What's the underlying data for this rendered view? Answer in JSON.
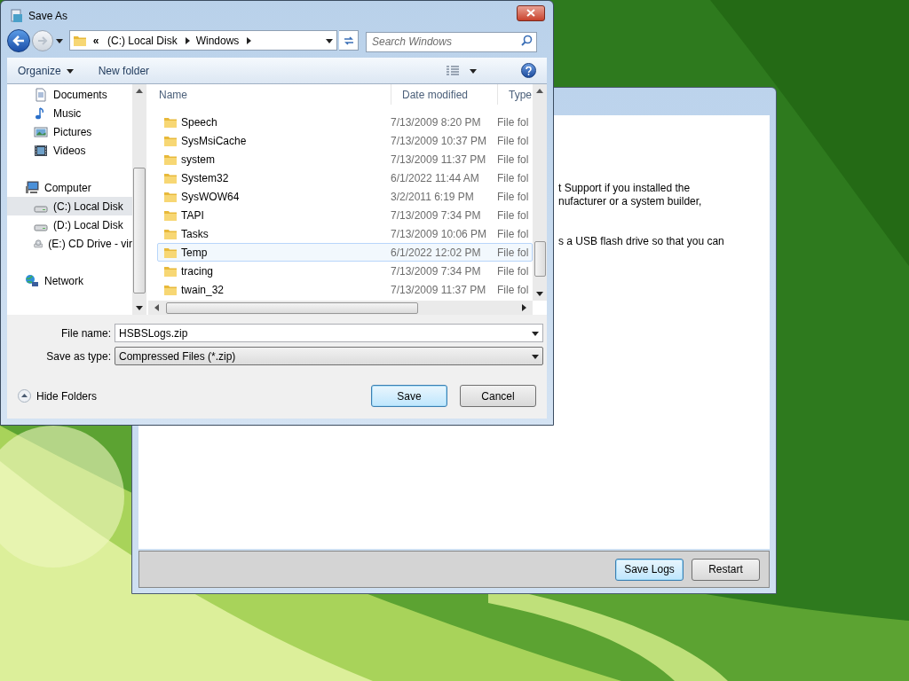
{
  "background_window": {
    "text_lines": [
      "t Support if you installed the",
      "nufacturer or a system builder,",
      "s a USB flash drive so that you can"
    ],
    "buttons": [
      {
        "label": "Save Logs",
        "default": true
      },
      {
        "label": "Restart",
        "default": false
      }
    ]
  },
  "dialog": {
    "title": "Save As",
    "breadcrumb": {
      "overflow": "«",
      "parts": [
        "(C:) Local Disk",
        "Windows"
      ]
    },
    "search": {
      "placeholder": "Search Windows"
    },
    "toolbar": [
      {
        "label": "Organize",
        "dropdown": true
      },
      {
        "label": "New folder",
        "dropdown": false
      }
    ],
    "nav": [
      {
        "kind": "documents",
        "label": "Documents",
        "selected": false
      },
      {
        "kind": "music",
        "label": "Music",
        "selected": false
      },
      {
        "kind": "pictures",
        "label": "Pictures",
        "selected": false
      },
      {
        "kind": "videos",
        "label": "Videos",
        "selected": false
      },
      {
        "kind": "computer",
        "label": "Computer",
        "selected": false,
        "children": [
          {
            "kind": "disk",
            "label": "(C:) Local Disk",
            "selected": true
          },
          {
            "kind": "disk",
            "label": "(D:) Local Disk",
            "selected": false
          },
          {
            "kind": "cd",
            "label": "(E:) CD Drive - vir",
            "selected": false
          }
        ]
      },
      {
        "kind": "network",
        "label": "Network",
        "selected": false
      }
    ],
    "columns": [
      "Name",
      "Date modified",
      "Type"
    ],
    "rows": [
      {
        "name": "Speech",
        "date": "7/13/2009 8:20 PM",
        "type": "File fol",
        "hovered": false
      },
      {
        "name": "SysMsiCache",
        "date": "7/13/2009 10:37 PM",
        "type": "File fol",
        "hovered": false
      },
      {
        "name": "system",
        "date": "7/13/2009 11:37 PM",
        "type": "File fol",
        "hovered": false
      },
      {
        "name": "System32",
        "date": "6/1/2022 11:44 AM",
        "type": "File fol",
        "hovered": false
      },
      {
        "name": "SysWOW64",
        "date": "3/2/2011 6:19 PM",
        "type": "File fol",
        "hovered": false
      },
      {
        "name": "TAPI",
        "date": "7/13/2009 7:34 PM",
        "type": "File fol",
        "hovered": false
      },
      {
        "name": "Tasks",
        "date": "7/13/2009 10:06 PM",
        "type": "File fol",
        "hovered": false
      },
      {
        "name": "Temp",
        "date": "6/1/2022 12:02 PM",
        "type": "File fol",
        "hovered": true
      },
      {
        "name": "tracing",
        "date": "7/13/2009 7:34 PM",
        "type": "File fol",
        "hovered": false
      },
      {
        "name": "twain_32",
        "date": "7/13/2009 11:37 PM",
        "type": "File fol",
        "hovered": false
      }
    ],
    "file_name": {
      "label": "File name:",
      "value": "HSBSLogs.zip"
    },
    "save_type": {
      "label": "Save as type:",
      "value": "Compressed Files (*.zip)"
    },
    "hide_folders": "Hide Folders",
    "buttons": [
      {
        "label": "Save",
        "default": true
      },
      {
        "label": "Cancel",
        "default": false
      }
    ]
  }
}
